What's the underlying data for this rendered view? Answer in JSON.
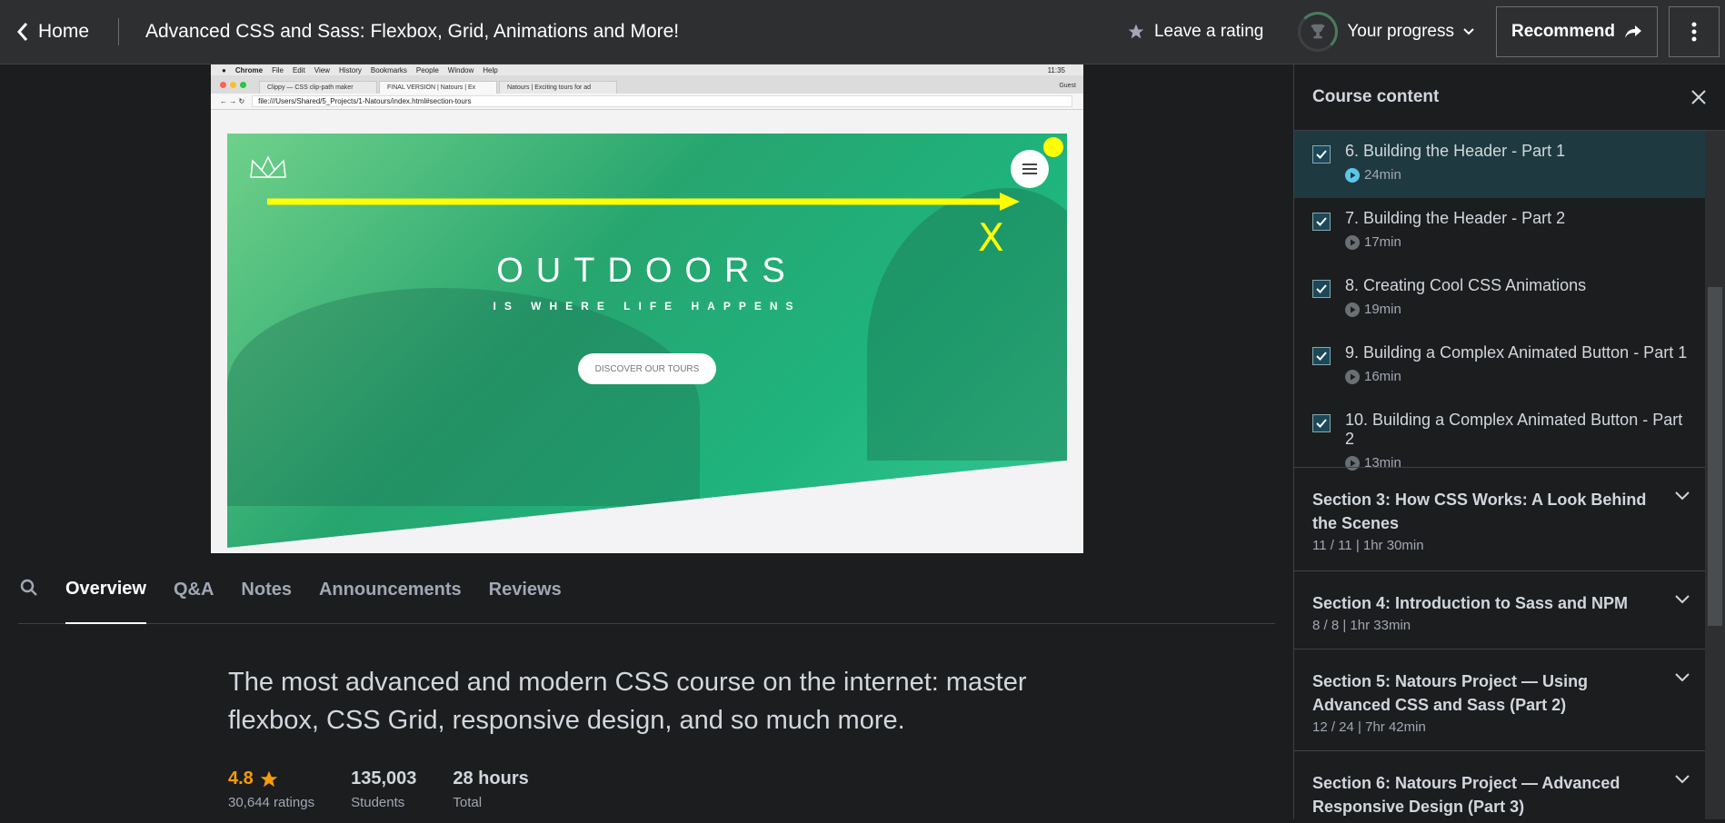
{
  "header": {
    "home_label": "Home",
    "course_title": "Advanced CSS and Sass: Flexbox, Grid, Animations and More!",
    "rating_label": "Leave a rating",
    "progress_label": "Your progress",
    "recommend_label": "Recommend"
  },
  "video": {
    "mac_menu": [
      "Chrome",
      "File",
      "Edit",
      "View",
      "History",
      "Bookmarks",
      "People",
      "Window",
      "Help"
    ],
    "clock": "11:35",
    "tabs": [
      "Clippy — CSS clip-path maker",
      "FINAL VERSION | Natours | Ex",
      "Natours | Exciting tours for ad"
    ],
    "guest": "Guest",
    "url": "file:///Users/Shared/5_Projects/1-Natours/index.html#section-tours",
    "hero_title": "OUTDOORS",
    "hero_subtitle": "IS WHERE LIFE HAPPENS",
    "hero_button": "DISCOVER OUR TOURS",
    "annotation_x": "X"
  },
  "tabs": [
    "Overview",
    "Q&A",
    "Notes",
    "Announcements",
    "Reviews"
  ],
  "overview": {
    "description": "The most advanced and modern CSS course on the internet: master flexbox, CSS Grid, responsive design, and so much more.",
    "rating": "4.8",
    "rating_count": "30,644 ratings",
    "students": "135,003",
    "students_label": "Students",
    "hours": "28 hours",
    "hours_label": "Total"
  },
  "sidebar": {
    "title": "Course content",
    "lectures": [
      {
        "title": "6. Building the Header - Part 1",
        "time": "24min"
      },
      {
        "title": "7. Building the Header - Part 2",
        "time": "17min"
      },
      {
        "title": "8. Creating Cool CSS Animations",
        "time": "19min"
      },
      {
        "title": "9. Building a Complex Animated Button - Part 1",
        "time": "16min"
      },
      {
        "title": "10. Building a Complex Animated Button - Part 2",
        "time": "13min"
      }
    ],
    "sections": [
      {
        "title": "Section 3: How CSS Works: A Look Behind the Scenes",
        "meta": "11 / 11 | 1hr 30min"
      },
      {
        "title": "Section 4: Introduction to Sass and NPM",
        "meta": "8 / 8 | 1hr 33min"
      },
      {
        "title": "Section 5: Natours Project — Using Advanced CSS and Sass (Part 2)",
        "meta": "12 / 24 | 7hr 42min"
      },
      {
        "title": "Section 6: Natours Project — Advanced Responsive Design (Part 3)",
        "meta": ""
      }
    ]
  },
  "colors": {
    "accent": "#f69c08",
    "annotation": "#ffff00",
    "current_lecture": "#1e3a40"
  }
}
